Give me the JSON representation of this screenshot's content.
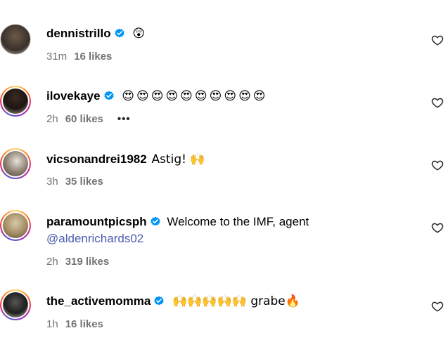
{
  "comments": [
    {
      "username": "dennistrillo",
      "verified": true,
      "text": "😲",
      "mention": "",
      "time": "31m",
      "likes": "16 likes",
      "more": ""
    },
    {
      "username": "ilovekaye",
      "verified": true,
      "text": "😍😍😍😍😍😍😍😍😍😍",
      "mention": "",
      "time": "2h",
      "likes": "60 likes",
      "more": "•••"
    },
    {
      "username": "vicsonandrei1982",
      "verified": false,
      "text": "Astig! 🙌",
      "mention": "",
      "time": "3h",
      "likes": "35 likes",
      "more": ""
    },
    {
      "username": "paramountpicsph",
      "verified": true,
      "text": "Welcome to the IMF, agent",
      "mention": "@aldenrichards02",
      "time": "2h",
      "likes": "319 likes",
      "more": ""
    },
    {
      "username": "the_activemomma",
      "verified": true,
      "text": "🙌🙌🙌🙌🙌 grabe🔥",
      "mention": "",
      "time": "1h",
      "likes": "16 likes",
      "more": ""
    }
  ],
  "icons": {
    "verified": "verified-badge-icon",
    "like": "heart-outline-icon"
  },
  "colors": {
    "verified": "#0095f6",
    "mention": "#4b5ab0",
    "meta": "#737373"
  }
}
